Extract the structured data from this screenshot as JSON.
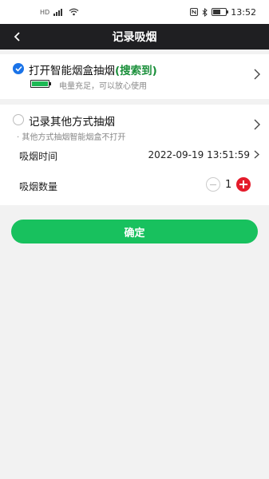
{
  "status_bar": {
    "left_icons": [
      "sim-icon",
      "signal-icon",
      "wifi-icon"
    ],
    "right_icons": [
      "nfc-icon",
      "bluetooth-icon",
      "battery-icon"
    ],
    "time": "13:52",
    "sim_label": "HD"
  },
  "header": {
    "title": "记录吸烟",
    "back_icon": "back-arrow-icon"
  },
  "option_box": {
    "title": "打开智能烟盒抽烟",
    "status": "(搜索到)",
    "battery_text": "电量充足，可以放心使用",
    "selected": true
  },
  "option_other": {
    "title": "记录其他方式抽烟",
    "subtitle": "其他方式抽烟智能烟盒不打开",
    "selected": false,
    "time_label": "吸烟时间",
    "time_value": "2022-09-19 13:51:59",
    "count_label": "吸烟数量",
    "count_value": "1"
  },
  "confirm_label": "确定",
  "colors": {
    "header_bg": "#1f1f22",
    "accent_blue": "#1a73e8",
    "found_green": "#1a8f3a",
    "confirm_green": "#18c15e",
    "plus_red": "#e41b2b"
  }
}
